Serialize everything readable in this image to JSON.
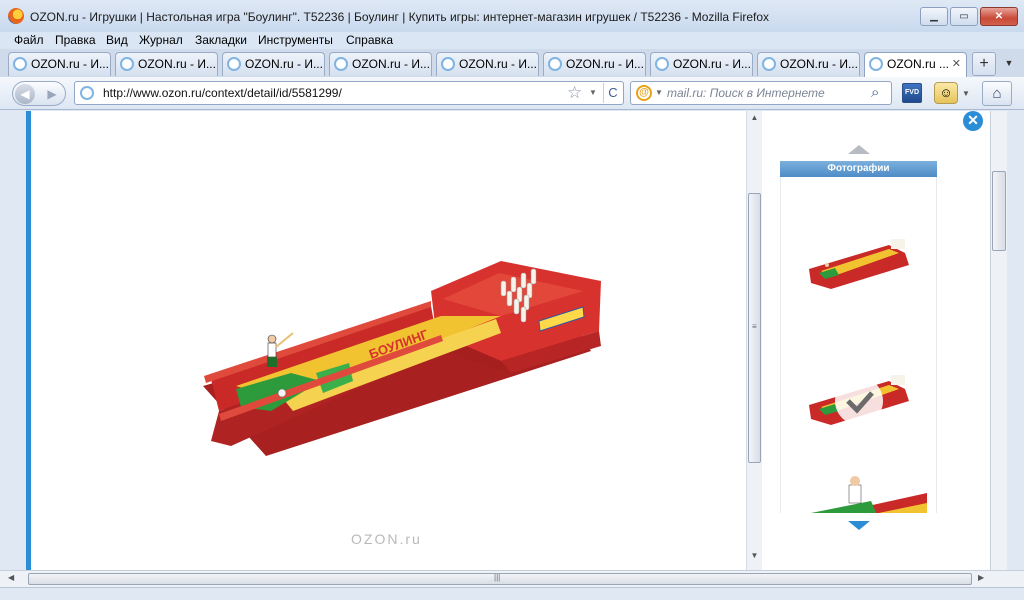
{
  "window": {
    "title": "OZON.ru - Игрушки | Настольная игра \"Боулинг\". T52236 | Боулинг | Купить игры: интернет-магазин игрушек / T52236 - Mozilla Firefox",
    "minimize_label": "▁",
    "maximize_label": "▭",
    "close_label": "✕"
  },
  "menu": {
    "items": [
      {
        "label": "Файл"
      },
      {
        "label": "Правка"
      },
      {
        "label": "Вид"
      },
      {
        "label": "Журнал"
      },
      {
        "label": "Закладки"
      },
      {
        "label": "Инструменты"
      },
      {
        "label": "Справка"
      }
    ]
  },
  "tabs": {
    "items": [
      {
        "label": "OZON.ru - И..."
      },
      {
        "label": "OZON.ru - И..."
      },
      {
        "label": "OZON.ru - И..."
      },
      {
        "label": "OZON.ru - И..."
      },
      {
        "label": "OZON.ru - И..."
      },
      {
        "label": "OZON.ru - И..."
      },
      {
        "label": "OZON.ru - И..."
      },
      {
        "label": "OZON.ru - И..."
      },
      {
        "label": "OZON.ru ..."
      }
    ],
    "close_label": "✕",
    "new_tab_label": "+",
    "list_label": "▼"
  },
  "nav": {
    "back_label": "◀",
    "forward_label": "▶",
    "url": "http://www.ozon.ru/context/detail/id/5581299/",
    "reload_label": "C",
    "search_engine_label": "@",
    "search_placeholder": "mail.ru: Поиск в Интернете",
    "fvd_label": "FVD",
    "addon_label": "☺",
    "home_label": "⌂"
  },
  "viewer": {
    "watermark": "OZON.ru",
    "close_label": "✕",
    "photos_header": "Фотографии",
    "product_title_on_box": "БОУЛИНГ",
    "thumbnails": [
      {
        "name": "photo-1"
      },
      {
        "name": "photo-2",
        "selected": true
      },
      {
        "name": "photo-3"
      }
    ]
  },
  "colors": {
    "accent": "#2b8dd6",
    "toy_red": "#d8322f",
    "toy_yellow": "#f2c330",
    "toy_green": "#2d9a3c"
  }
}
